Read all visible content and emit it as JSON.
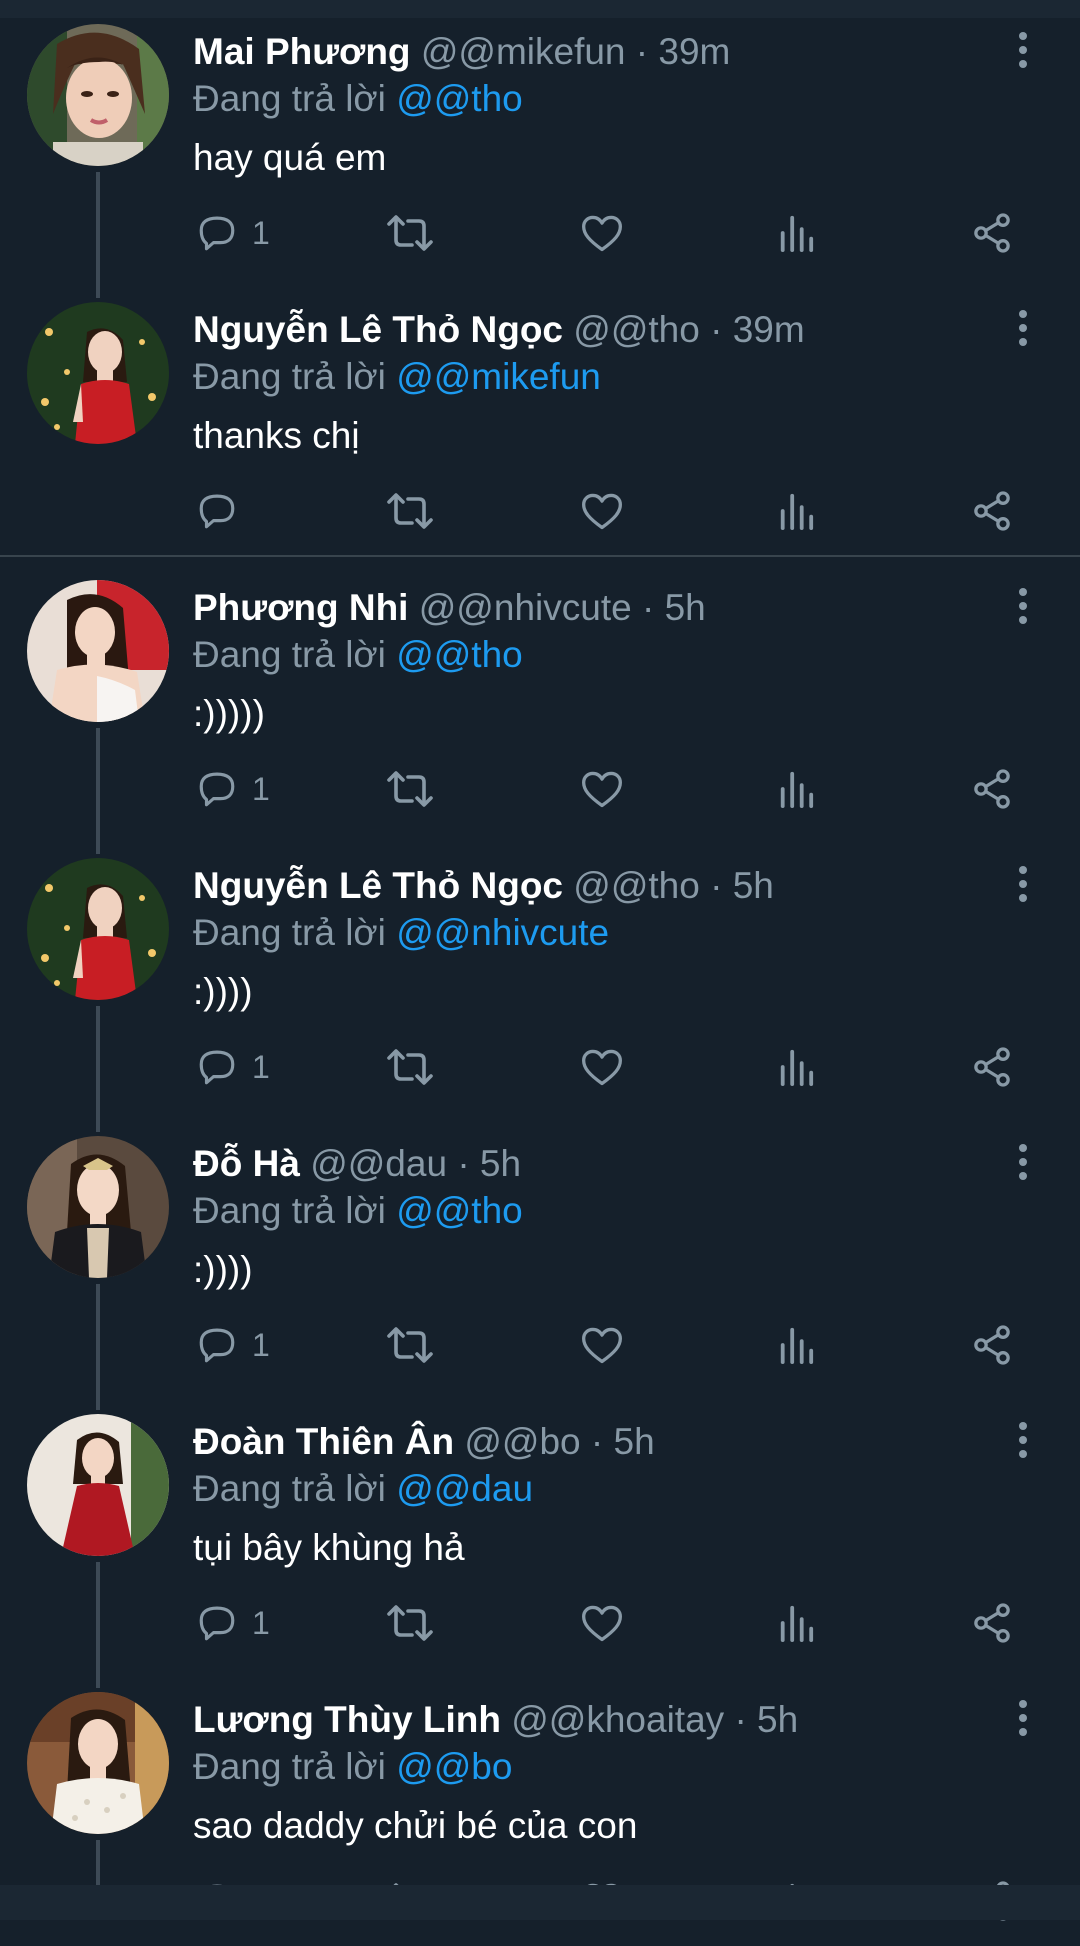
{
  "colors": {
    "background": "#15202b",
    "secondary_text": "#8899a6",
    "mention": "#1d9bf0",
    "thread_line": "#3d4a56"
  },
  "tweets": [
    {
      "name": "Mai Phương",
      "handle": "@@mikefun",
      "time": "· 39m",
      "reply_prefix": "Đang trả lời",
      "reply_to": "@@tho",
      "text": "hay quá em",
      "reply_count": "1"
    },
    {
      "name": "Nguyễn Lê Thỏ Ngọc",
      "handle": "@@tho",
      "time": "· 39m",
      "reply_prefix": "Đang trả lời",
      "reply_to": "@@mikefun",
      "text": "thanks chị",
      "reply_count": ""
    },
    {
      "name": "Phương Nhi",
      "handle": "@@nhivcute",
      "time": "· 5h",
      "reply_prefix": "Đang trả lời",
      "reply_to": "@@tho",
      "text": ":)))))",
      "reply_count": "1"
    },
    {
      "name": "Nguyễn Lê Thỏ Ngọc",
      "handle": "@@tho",
      "time": "· 5h",
      "reply_prefix": "Đang trả lời",
      "reply_to": "@@nhivcute",
      "text": ":))))",
      "reply_count": "1"
    },
    {
      "name": "Đỗ Hà",
      "handle": "@@dau",
      "time": "· 5h",
      "reply_prefix": "Đang trả lời",
      "reply_to": "@@tho",
      "text": ":))))",
      "reply_count": "1"
    },
    {
      "name": "Đoàn Thiên Ân",
      "handle": "@@bo",
      "time": "· 5h",
      "reply_prefix": "Đang trả lời",
      "reply_to": "@@dau",
      "text": "tụi bây khùng hả",
      "reply_count": "1"
    },
    {
      "name": "Lương Thùy Linh",
      "handle": "@@khoaitay",
      "time": "· 5h",
      "reply_prefix": "Đang trả lời",
      "reply_to": "@@bo",
      "text": "sao daddy chửi bé của con",
      "reply_count": ""
    }
  ]
}
